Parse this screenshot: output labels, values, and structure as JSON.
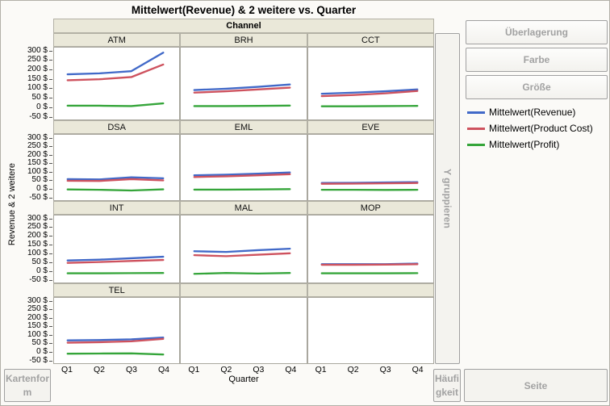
{
  "title": "Mittelwert(Revenue) & 2 weitere vs. Quarter",
  "x_group_label": "Channel",
  "y_axis": {
    "title": "Revenue & 2 weitere",
    "tick_labels": [
      "300 $",
      "250 $",
      "200 $",
      "150 $",
      "100 $",
      "50 $",
      "0 $",
      "-50 $"
    ],
    "tick_values": [
      300,
      250,
      200,
      150,
      100,
      50,
      0,
      -50
    ]
  },
  "x_axis": {
    "title": "Quarter",
    "tick_labels": [
      "Q1",
      "Q2",
      "Q3",
      "Q4"
    ]
  },
  "drop_zones": {
    "overlay": "Überlagerung",
    "color": "Farbe",
    "size": "Größe",
    "y_group": "Y gruppieren",
    "map_shape": "Kartenform",
    "frequency": "Häufigkeit",
    "page": "Seite"
  },
  "legend": [
    {
      "label": "Mittelwert(Revenue)",
      "color": "#4169c8"
    },
    {
      "label": "Mittelwert(Product Cost)",
      "color": "#ce525e"
    },
    {
      "label": "Mittelwert(Profit)",
      "color": "#35a53a"
    }
  ],
  "colors": {
    "panel_band": "#eae8d9",
    "panel_border": "#a9a79e",
    "plot_background": "#ffffff",
    "dropzone_text": "#a2a2a2"
  },
  "chart_data": {
    "type": "line",
    "title": "Mittelwert(Revenue) & 2 weitere vs. Quarter",
    "panel_variable": "Channel",
    "categories": [
      "Q1",
      "Q2",
      "Q3",
      "Q4"
    ],
    "xlabel": "Quarter",
    "ylabel": "Revenue & 2 weitere",
    "ylim": [
      -50,
      300
    ],
    "ytick_step": 50,
    "grid": false,
    "legend_position": "right",
    "panels": [
      {
        "name": "ATM",
        "series": [
          {
            "name": "Mittelwert(Revenue)",
            "values": [
              175,
              180,
              192,
              292
            ]
          },
          {
            "name": "Mittelwert(Product Cost)",
            "values": [
              143,
              148,
              160,
              228
            ]
          },
          {
            "name": "Mittelwert(Profit)",
            "values": [
              5,
              5,
              3,
              18
            ]
          }
        ]
      },
      {
        "name": "BRH",
        "series": [
          {
            "name": "Mittelwert(Revenue)",
            "values": [
              90,
              97,
              107,
              120
            ]
          },
          {
            "name": "Mittelwert(Product Cost)",
            "values": [
              76,
              83,
              93,
              103
            ]
          },
          {
            "name": "Mittelwert(Profit)",
            "values": [
              3,
              3,
              4,
              6
            ]
          }
        ]
      },
      {
        "name": "CCT",
        "series": [
          {
            "name": "Mittelwert(Revenue)",
            "values": [
              70,
              76,
              83,
              93
            ]
          },
          {
            "name": "Mittelwert(Product Cost)",
            "values": [
              57,
              63,
              72,
              85
            ]
          },
          {
            "name": "Mittelwert(Profit)",
            "values": [
              2,
              2,
              3,
              4
            ]
          }
        ]
      },
      {
        "name": "DSA",
        "series": [
          {
            "name": "Mittelwert(Revenue)",
            "values": [
              55,
              53,
              66,
              60
            ]
          },
          {
            "name": "Mittelwert(Product Cost)",
            "values": [
              45,
              44,
              55,
              48
            ]
          },
          {
            "name": "Mittelwert(Profit)",
            "values": [
              -7,
              -9,
              -13,
              -6
            ]
          }
        ]
      },
      {
        "name": "EML",
        "series": [
          {
            "name": "Mittelwert(Revenue)",
            "values": [
              78,
              82,
              88,
              95
            ]
          },
          {
            "name": "Mittelwert(Product Cost)",
            "values": [
              68,
              72,
              78,
              85
            ]
          },
          {
            "name": "Mittelwert(Profit)",
            "values": [
              -8,
              -8,
              -7,
              -5
            ]
          }
        ]
      },
      {
        "name": "EVE",
        "series": [
          {
            "name": "Mittelwert(Revenue)",
            "values": [
              32,
              33,
              35,
              37
            ]
          },
          {
            "name": "Mittelwert(Product Cost)",
            "values": [
              27,
              28,
              30,
              32
            ]
          },
          {
            "name": "Mittelwert(Profit)",
            "values": [
              -9,
              -9,
              -10,
              -9
            ]
          }
        ]
      },
      {
        "name": "INT",
        "series": [
          {
            "name": "Mittelwert(Revenue)",
            "values": [
              58,
              63,
              71,
              80
            ]
          },
          {
            "name": "Mittelwert(Product Cost)",
            "values": [
              44,
              49,
              55,
              61
            ]
          },
          {
            "name": "Mittelwert(Profit)",
            "values": [
              -17,
              -17,
              -16,
              -15
            ]
          }
        ]
      },
      {
        "name": "MAL",
        "series": [
          {
            "name": "Mittelwert(Revenue)",
            "values": [
              112,
              108,
              118,
              127
            ]
          },
          {
            "name": "Mittelwert(Product Cost)",
            "values": [
              89,
              83,
              92,
              100
            ]
          },
          {
            "name": "Mittelwert(Profit)",
            "values": [
              -20,
              -15,
              -18,
              -15
            ]
          }
        ]
      },
      {
        "name": "MOP",
        "series": [
          {
            "name": "Mittelwert(Revenue)",
            "values": [
              36,
              36,
              36,
              40
            ]
          },
          {
            "name": "Mittelwert(Product Cost)",
            "values": [
              33,
              33,
              34,
              36
            ]
          },
          {
            "name": "Mittelwert(Profit)",
            "values": [
              -17,
              -17,
              -17,
              -16
            ]
          }
        ]
      },
      {
        "name": "TEL",
        "series": [
          {
            "name": "Mittelwert(Revenue)",
            "values": [
              66,
              68,
              72,
              83
            ]
          },
          {
            "name": "Mittelwert(Product Cost)",
            "values": [
              52,
              55,
              60,
              75
            ]
          },
          {
            "name": "Mittelwert(Profit)",
            "values": [
              -14,
              -13,
              -12,
              -19
            ]
          }
        ]
      }
    ]
  }
}
